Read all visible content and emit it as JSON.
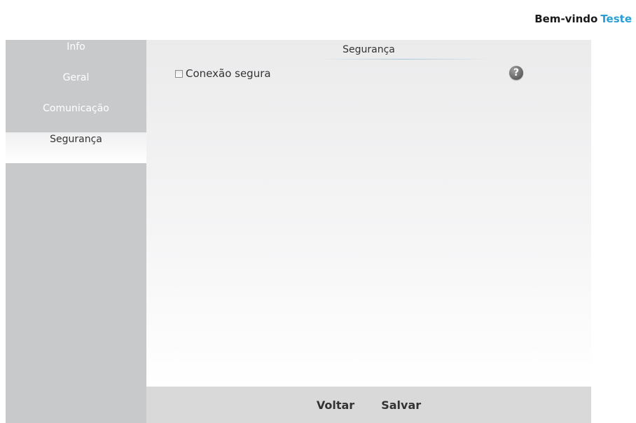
{
  "header": {
    "welcome_label": "Bem-vindo",
    "user_name": "Teste",
    "user_color": "#2a9fd6"
  },
  "sidebar": {
    "items": [
      {
        "label": "Info",
        "active": false
      },
      {
        "label": "Geral",
        "active": false
      },
      {
        "label": "Comunicação",
        "active": false
      },
      {
        "label": "Segurança",
        "active": true
      }
    ]
  },
  "main": {
    "section_title": "Segurança",
    "options": [
      {
        "label": "Conexão segura",
        "checked": false
      }
    ],
    "help_icon": "help-icon",
    "help_glyph": "?"
  },
  "footer": {
    "back_label": "Voltar",
    "save_label": "Salvar"
  }
}
